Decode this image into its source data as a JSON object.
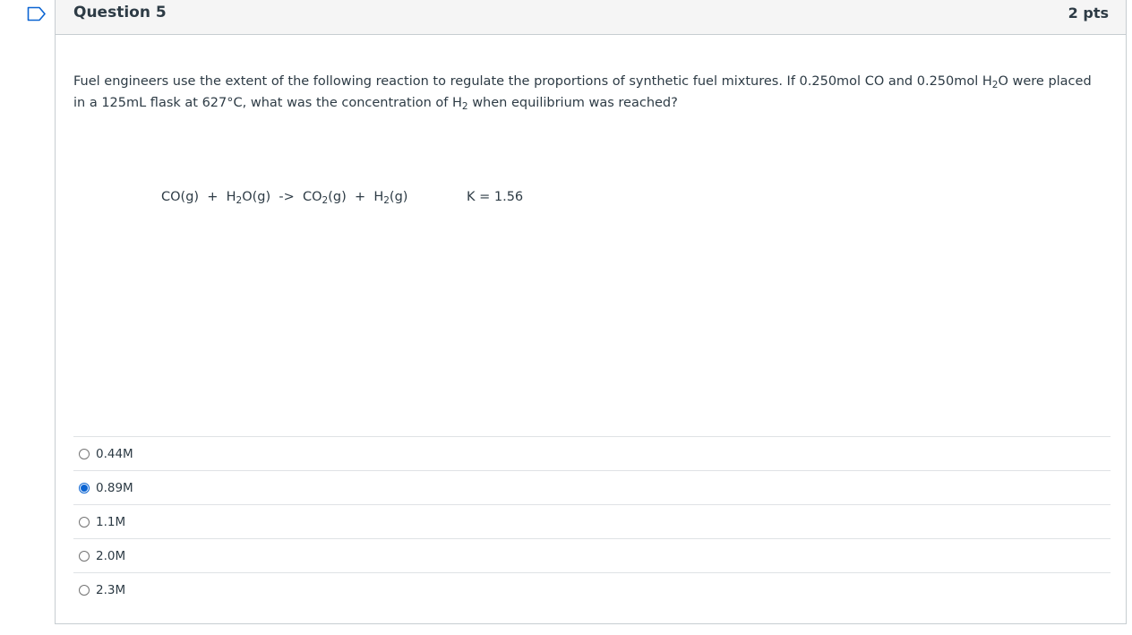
{
  "question": {
    "title": "Question 5",
    "points": "2 pts",
    "text_parts": {
      "p1": "Fuel engineers use the extent of the following reaction to regulate the proportions of synthetic fuel mixtures.  If 0.250mol CO and 0.250mol H",
      "sub1": "2",
      "p2": "O were placed in a 125mL flask at 627°C, what was the concentration of H",
      "sub2": "2",
      "p3": " when equilibrium was reached?"
    },
    "equation": {
      "t1": "CO(g)  +  H",
      "s1": "2",
      "t2": "O(g)  ->  CO",
      "s2": "2",
      "t3": "(g)  +  H",
      "s3": "2",
      "t4": "(g)"
    },
    "k_value": "K = 1.56"
  },
  "answers": [
    {
      "label": "0.44M",
      "selected": false
    },
    {
      "label": "0.89M",
      "selected": true
    },
    {
      "label": "1.1M",
      "selected": false
    },
    {
      "label": "2.0M",
      "selected": false
    },
    {
      "label": "2.3M",
      "selected": false
    }
  ],
  "colors": {
    "accent": "#0b64d2",
    "text": "#2d3b45",
    "header_bg": "#f5f5f5",
    "border": "#c7cdd1"
  },
  "icons": {
    "bookmark": "bookmark-flag-icon"
  }
}
